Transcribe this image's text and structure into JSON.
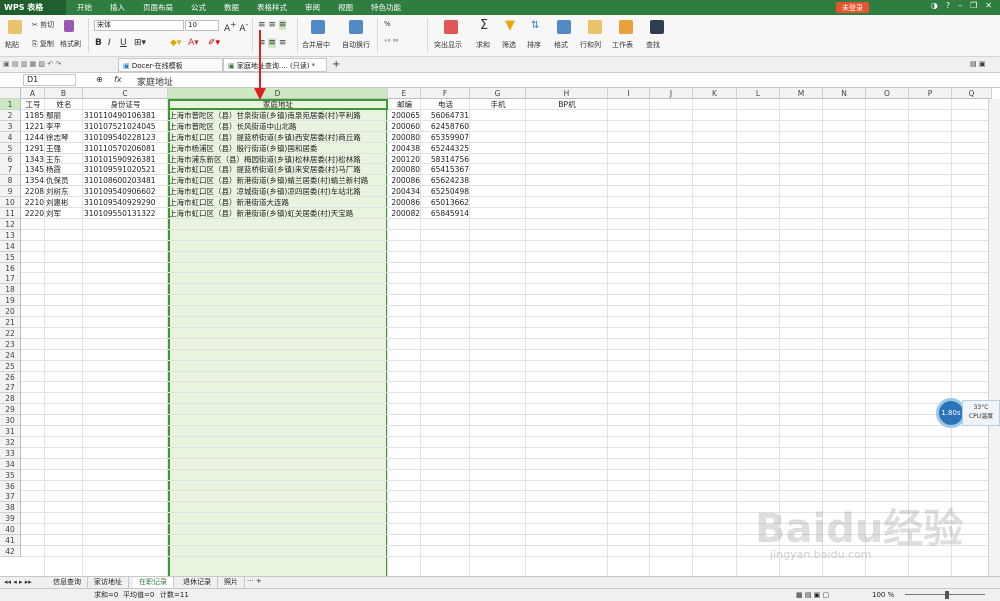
{
  "app": {
    "logo": "WPS 表格",
    "login": "未登录"
  },
  "menu": [
    "开始",
    "插入",
    "页面布局",
    "公式",
    "数据",
    "表格样式",
    "审阅",
    "视图",
    "特色功能"
  ],
  "ribbon": {
    "paste": "粘贴",
    "cut": "剪切",
    "copy": "复制",
    "format_painter": "格式刷",
    "font": "宋体",
    "font_size": "10",
    "merge": "合并居中",
    "wrap": "自动换行",
    "percent": "%",
    "highlight": "突出显示",
    "sum": "求和",
    "filter": "筛选",
    "sort": "排序",
    "format": "格式",
    "rowcol": "行和列",
    "worksheet": "工作表",
    "find": "查找"
  },
  "doc_tabs": [
    "Docer-在线模板",
    "家庭地址查询.... (只读) *"
  ],
  "formula": {
    "namebox": "D1",
    "fx": "fx",
    "content": "家庭地址"
  },
  "columns": [
    "A",
    "B",
    "C",
    "D",
    "E",
    "F",
    "G",
    "H",
    "I",
    "J",
    "K",
    "L",
    "M",
    "N",
    "O",
    "P",
    "Q"
  ],
  "headers": [
    "工号",
    "姓名",
    "身份证号",
    "家庭地址",
    "邮编",
    "电话",
    "手机",
    "BP机"
  ],
  "rows": [
    [
      "1185",
      "鄢丽",
      "310110490106381",
      "上海市普陀区（县）甘泉街道(乡镇)南泉宛居委(村)平利路",
      "200065",
      "56064731"
    ],
    [
      "1221",
      "李平",
      "310107521024045",
      "上海市普陀区（县）长风街道中山北路",
      "200060",
      "62458760"
    ],
    [
      "1244",
      "徐志琴",
      "310109540228123",
      "上海市虹口区（县）提篮桥街道(乡镇)西安居委(村)商丘路",
      "200080",
      "65359907"
    ],
    [
      "1291",
      "王强",
      "310110570206081",
      "上海市杨浦区（县）殷行街道(乡镇)国和居委",
      "200438",
      "65244325"
    ],
    [
      "1343",
      "王东",
      "310101590926381",
      "上海市浦东新区（县）梅园街道(乡镇)松林居委(村)松林路",
      "200120",
      "58314756"
    ],
    [
      "1345",
      "杨霞",
      "310109591020521",
      "上海市虹口区（县）提篮桥街道(乡镇)来安居委(村)马厂路",
      "200080",
      "65415367"
    ],
    [
      "1354",
      "仇保员",
      "310108600203481",
      "上海市虹口区（县）新港街道(乡镇)蜻兰居委(村)蜻兰新村路",
      "200086",
      "65624238"
    ],
    [
      "2208",
      "刘树东",
      "310109540906602",
      "上海市虹口区（县）凉城街道(乡镇)凉四居委(村)车站北路",
      "200434",
      "65250498"
    ],
    [
      "2210",
      "刘惠彬",
      "310109540929290",
      "上海市虹口区（县）新港街道大连路",
      "200086",
      "65013662"
    ],
    [
      "2220",
      "刘军",
      "310109550131322",
      "上海市虹口区（县）新港街道(乡镇)虹关居委(村)天宝路",
      "200082",
      "65845914"
    ]
  ],
  "row_numbers": [
    "1",
    "2",
    "3",
    "4",
    "5",
    "6",
    "7",
    "8",
    "9",
    "10",
    "11",
    "12",
    "13",
    "14",
    "15",
    "16",
    "17",
    "18",
    "19",
    "20",
    "21",
    "22",
    "23",
    "24",
    "25",
    "26",
    "27",
    "28",
    "29",
    "30",
    "31",
    "32",
    "33",
    "34",
    "35",
    "36",
    "37",
    "38",
    "39",
    "40",
    "41",
    "42"
  ],
  "sheets": [
    "信息查询",
    "家访地址",
    "在职记录",
    "退休记录",
    "照片"
  ],
  "status": {
    "sum": "求和=0",
    "avg": "平均值=0",
    "count": "计数=11",
    "zoom": "100 %"
  },
  "cpu": {
    "value": "1.80s",
    "temp": "33°C",
    "label": "CPU温度"
  },
  "watermark": {
    "brand": "Baidu经验",
    "url": "jingyan.baidu.com"
  }
}
